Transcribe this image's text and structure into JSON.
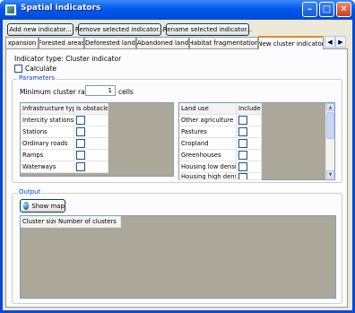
{
  "window": {
    "title": "Spatial indicators"
  },
  "toolbar": {
    "add_label": "Add new indicator...",
    "remove_label": "Remove selected indicator...",
    "rename_label": "Rename selected indicator..."
  },
  "tabs": [
    {
      "label": "xpansion"
    },
    {
      "label": "Forested areas"
    },
    {
      "label": "Deforested land"
    },
    {
      "label": "Abandoned land"
    },
    {
      "label": "Habitat fragmentation"
    },
    {
      "label": "New cluster indicator"
    }
  ],
  "indicator": {
    "type_label": "Indicator type: Cluster indicator",
    "calculate_label": "Calculate"
  },
  "parameters": {
    "legend": "Parameters",
    "radius_label": "Minimum cluster radius:",
    "radius_value": "1",
    "radius_unit": "cells"
  },
  "infrastructure_table": {
    "headers": [
      "Infrastructure type",
      "Is obstacle"
    ],
    "rows": [
      "Intercity stations",
      "Stations",
      "Ordinary roads",
      "Ramps",
      "Waterways"
    ]
  },
  "landuse_table": {
    "headers": [
      "Land use",
      "Include"
    ],
    "rows": [
      "Other agriculture",
      "Pastures",
      "Cropland",
      "Greenhouses",
      "Housing low density",
      "Housing high density"
    ]
  },
  "output": {
    "legend": "Output",
    "show_map_label": "Show map",
    "headers": [
      "Cluster size [ha]",
      "Number of clusters"
    ]
  }
}
